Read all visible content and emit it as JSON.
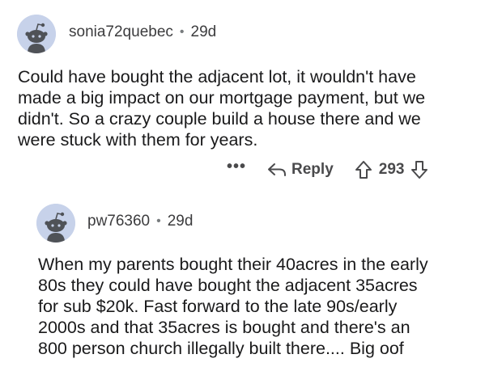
{
  "comments": [
    {
      "username": "sonia72quebec",
      "separator": "•",
      "age": "29d",
      "body_lines": [
        "Could have bought the adjacent lot, it wouldn't have",
        "made a big impact on our mortgage payment, but we",
        "didn't.  So a crazy couple build a house there and we",
        "were stuck with them for years."
      ],
      "actions": {
        "more": "•••",
        "reply": "Reply",
        "score": "293"
      }
    },
    {
      "username": "pw76360",
      "separator": "•",
      "age": "29d",
      "body_lines": [
        "When my parents bought their 40acres in the early",
        "80s they could have bought the adjacent 35acres",
        "for sub $20k. Fast forward to the late 90s/early",
        "2000s and that 35acres is bought and there's an",
        "800 person church illegally built there.... Big oof"
      ]
    }
  ],
  "icons": {
    "avatar": "snoo-avatar-icon",
    "reply": "reply-arrow-icon",
    "upvote": "upvote-arrow-icon",
    "downvote": "downvote-arrow-icon"
  },
  "colors": {
    "avatar_bg": "#c7d2ea",
    "text": "#1a1a1b",
    "meta": "#3c3c3e"
  }
}
